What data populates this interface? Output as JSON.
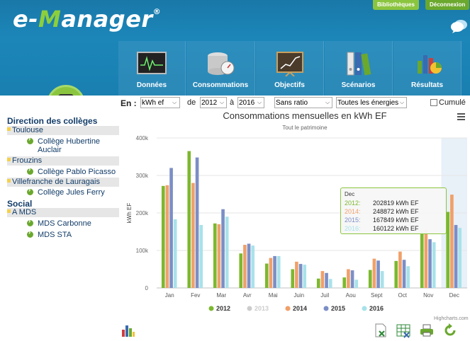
{
  "header": {
    "logo_prefix": "e-",
    "logo_m": "M",
    "logo_rest": "anager",
    "logo_reg": "®",
    "bibliotheques": "Bibliothèques",
    "deconnexion": "Déconnexion"
  },
  "nav": [
    {
      "label": "Données",
      "icon": "monitor-chart-icon"
    },
    {
      "label": "Consommations",
      "icon": "database-gauge-icon"
    },
    {
      "label": "Objectifs",
      "icon": "target-board-icon"
    },
    {
      "label": "Scénarios",
      "icon": "binders-icon"
    },
    {
      "label": "Résultats",
      "icon": "results-chart-icon"
    }
  ],
  "filters": {
    "en_label": "En :",
    "unit": "kWh ef",
    "de_label": "de",
    "from_year": "2012",
    "a_label": "à",
    "to_year": "2016",
    "ratio": "Sans ratio",
    "energy": "Toutes les énergies",
    "cumule": "Cumulé"
  },
  "tree": {
    "groups": [
      {
        "title": "Direction des collèges",
        "areas": [
          {
            "name": "Toulouse",
            "items": [
              "Collège Hubertine Auclair"
            ]
          },
          {
            "name": "Frouzins",
            "items": [
              "Collège Pablo Picasso"
            ]
          },
          {
            "name": "Villefranche de Lauragais",
            "items": [
              "Collège Jules Ferry"
            ]
          }
        ]
      },
      {
        "title": "Social",
        "areas": [
          {
            "name": "A MDS",
            "items": [
              "MDS Carbonne",
              "MDS STA"
            ]
          }
        ]
      }
    ]
  },
  "chart_data": {
    "type": "bar",
    "title": "Consommations mensuelles en kWh EF",
    "subtitle": "Tout le patrimoine",
    "ylabel": "kWh EF",
    "ylim": [
      0,
      400000
    ],
    "yticks": [
      "0",
      "100k",
      "200k",
      "300k",
      "400k"
    ],
    "categories": [
      "Jan",
      "Fev",
      "Mar",
      "Avr",
      "Mai",
      "Juin",
      "Juil",
      "Aou",
      "Sept",
      "Oct",
      "Nov",
      "Dec"
    ],
    "highlighted_category": "Dec",
    "legend_position": "bottom",
    "series": [
      {
        "name": "2012",
        "color": "#7cb82f",
        "visible": true,
        "values": [
          272000,
          365000,
          172000,
          92000,
          65000,
          50000,
          25000,
          28000,
          48000,
          72000,
          150000,
          202819
        ]
      },
      {
        "name": "2013",
        "color": "#c8c8c8",
        "visible": false,
        "values": []
      },
      {
        "name": "2014",
        "color": "#f0a06a",
        "visible": true,
        "values": [
          274000,
          280000,
          170000,
          115000,
          80000,
          70000,
          45000,
          50000,
          78000,
          97000,
          155000,
          248872
        ]
      },
      {
        "name": "2015",
        "color": "#7c8ec6",
        "visible": true,
        "values": [
          320000,
          348000,
          210000,
          118000,
          85000,
          64000,
          40000,
          47000,
          73000,
          75000,
          130000,
          167849
        ]
      },
      {
        "name": "2016",
        "color": "#a8e2ea",
        "visible": true,
        "values": [
          183000,
          168000,
          190000,
          113000,
          85000,
          62000,
          24000,
          22000,
          45000,
          58000,
          122000,
          160122
        ]
      }
    ],
    "credit": "Highcharts.com"
  },
  "tooltip": {
    "title": "Dec",
    "rows": [
      {
        "year": "2012:",
        "value": "202819 kWh EF",
        "color": "#7cb82f"
      },
      {
        "year": "2014:",
        "value": "248872 kWh EF",
        "color": "#f0a06a"
      },
      {
        "year": "2015:",
        "value": "167849 kWh EF",
        "color": "#7c8ec6"
      },
      {
        "year": "2016:",
        "value": "160122 kWh EF",
        "color": "#a8e2ea"
      }
    ]
  },
  "bottom_icons": [
    "bar-chart-icon",
    "excel-export-icon",
    "grid-export-icon",
    "print-icon",
    "refresh-icon"
  ]
}
